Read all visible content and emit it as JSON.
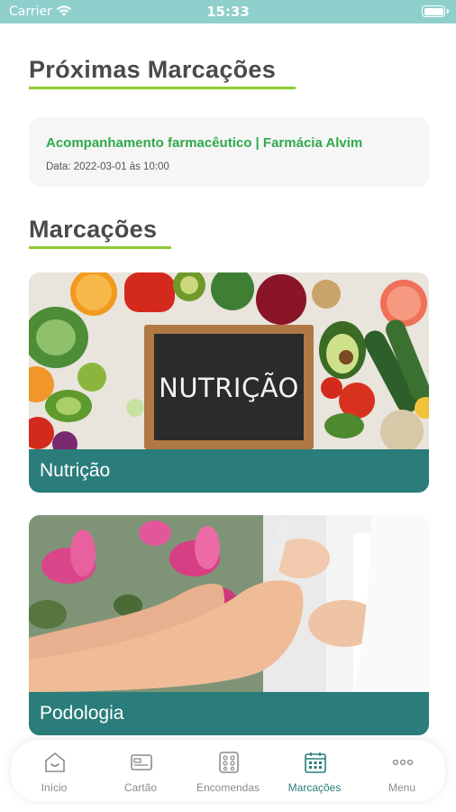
{
  "status_bar": {
    "carrier": "Carrier",
    "time": "15:33"
  },
  "upcoming": {
    "title": "Próximas Marcações",
    "appointment": {
      "title": "Acompanhamento farmacêutico | Farmácia Alvim",
      "date": "Data: 2022-03-01 às 10:00"
    }
  },
  "bookings": {
    "title": "Marcações",
    "services": [
      {
        "label": "Nutrição",
        "image_text": "NUTRIÇÃO"
      },
      {
        "label": "Podologia"
      }
    ]
  },
  "nav": {
    "items": [
      {
        "label": "Início",
        "icon": "home-icon"
      },
      {
        "label": "Cartão",
        "icon": "card-icon"
      },
      {
        "label": "Encomendas",
        "icon": "orders-icon"
      },
      {
        "label": "Marcações",
        "icon": "calendar-icon"
      },
      {
        "label": "Menu",
        "icon": "more-icon"
      }
    ],
    "active_color": "#2a7d7a",
    "inactive_color": "#8b8b8b"
  },
  "colors": {
    "accent_green": "#8fcb2f",
    "teal": "#2a7d7a",
    "link_green": "#2faa4a",
    "status_bar": "#8fcfcc"
  }
}
